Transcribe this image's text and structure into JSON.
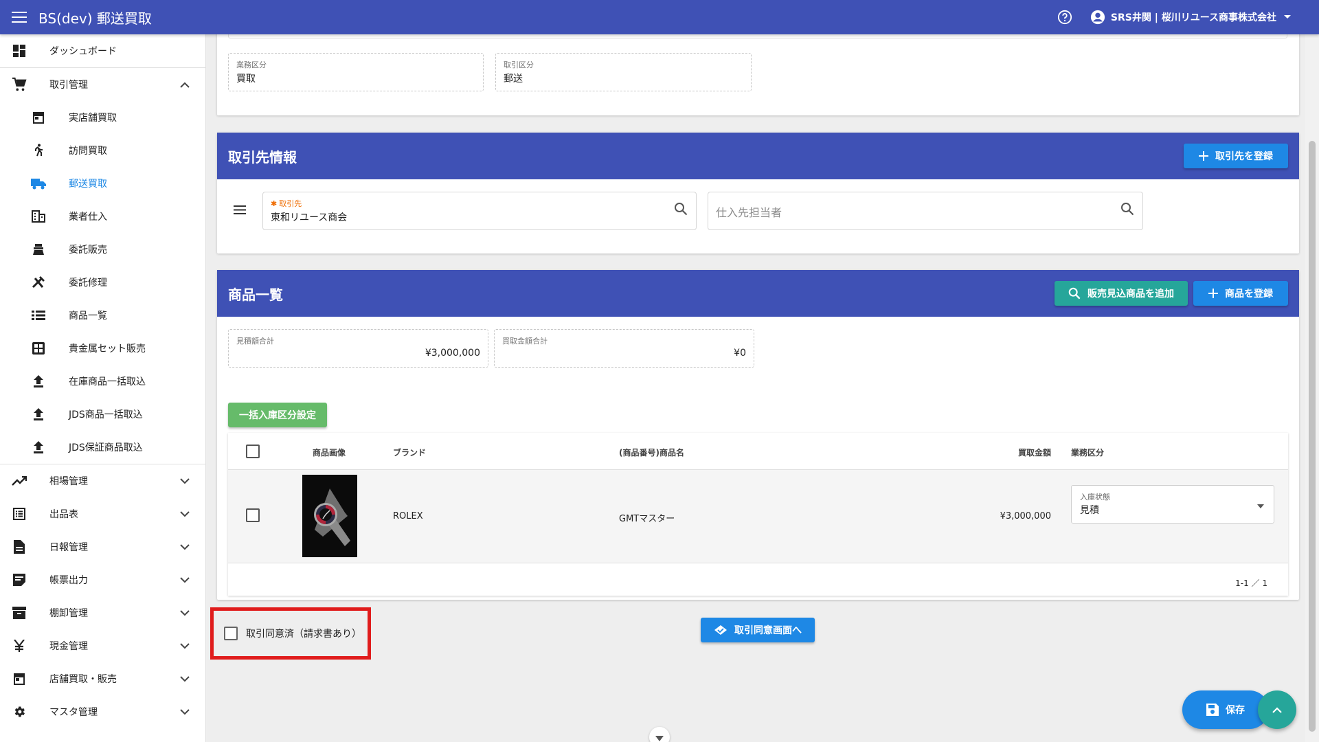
{
  "app": {
    "title": "BS(dev) 郵送買取",
    "user": "SRS井関 | 桜川リユース商事株式会社"
  },
  "sidebar": {
    "items": [
      {
        "label": "ダッシュボード"
      },
      {
        "label": "取引管理"
      },
      {
        "label": "実店舗買取"
      },
      {
        "label": "訪問買取"
      },
      {
        "label": "郵送買取"
      },
      {
        "label": "業者仕入"
      },
      {
        "label": "委託販売"
      },
      {
        "label": "委託修理"
      },
      {
        "label": "商品一覧"
      },
      {
        "label": "貴金属セット販売"
      },
      {
        "label": "在庫商品一括取込"
      },
      {
        "label": "JDS商品一括取込"
      },
      {
        "label": "JDS保証商品取込"
      },
      {
        "label": "相場管理"
      },
      {
        "label": "出品表"
      },
      {
        "label": "日報管理"
      },
      {
        "label": "帳票出力"
      },
      {
        "label": "棚卸管理"
      },
      {
        "label": "現金管理"
      },
      {
        "label": "店舗買取・販売"
      },
      {
        "label": "マスタ管理"
      }
    ]
  },
  "info": {
    "business_type_label": "業務区分",
    "business_type_value": "買取",
    "transaction_type_label": "取引区分",
    "transaction_type_value": "郵送"
  },
  "partner": {
    "title": "取引先情報",
    "register_btn": "取引先を登録",
    "partner_label": "取引先",
    "partner_value": "東和リユース商会",
    "contact_placeholder": "仕入先担当者"
  },
  "products": {
    "title": "商品一覧",
    "add_btn": "販売見込商品を追加",
    "register_btn": "商品を登録",
    "estimate_total_label": "見積額合計",
    "estimate_total_value": "¥3,000,000",
    "purchase_total_label": "買取金額合計",
    "purchase_total_value": "¥0",
    "bulk_btn": "一括入庫区分設定",
    "columns": [
      "商品画像",
      "ブランド",
      "(商品番号)商品名",
      "買取金額",
      "業務区分"
    ],
    "rows": [
      {
        "brand": "ROLEX",
        "name": "GMTマスター",
        "price": "¥3,000,000",
        "status_label": "入庫状態",
        "status_value": "見積"
      }
    ],
    "pagination": "1-1 ／ 1"
  },
  "footer": {
    "agree_label": "取引同意済（請求書あり）",
    "agree_btn": "取引同意画面へ",
    "save_btn": "保存"
  },
  "colors": {
    "primary": "#3f51b5",
    "accent": "#1e88e5",
    "teal": "#26a69a",
    "highlight": "#e01c1c"
  }
}
